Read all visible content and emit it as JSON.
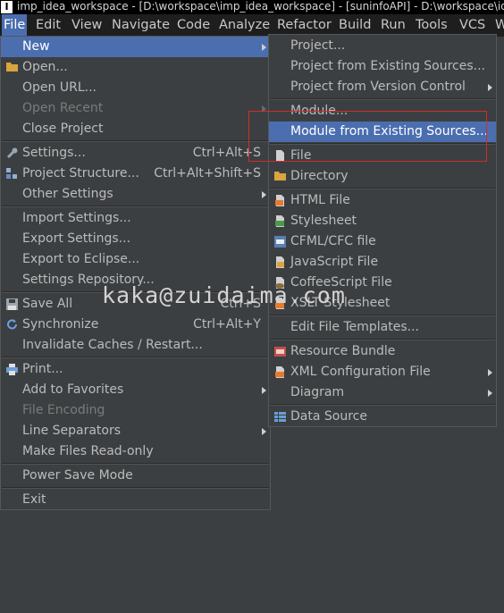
{
  "window": {
    "title": "imp_idea_workspace - [D:\\workspace\\imp_idea_workspace] - [suninfoAPI] - D:\\workspace\\idea"
  },
  "menubar": {
    "items": [
      {
        "label": "File"
      },
      {
        "label": "Edit"
      },
      {
        "label": "View"
      },
      {
        "label": "Navigate"
      },
      {
        "label": "Code"
      },
      {
        "label": "Analyze"
      },
      {
        "label": "Refactor"
      },
      {
        "label": "Build"
      },
      {
        "label": "Run"
      },
      {
        "label": "Tools"
      },
      {
        "label": "VCS"
      },
      {
        "label": "W"
      }
    ]
  },
  "file_menu": {
    "items": [
      {
        "label": "New"
      },
      {
        "label": "Open..."
      },
      {
        "label": "Open URL..."
      },
      {
        "label": "Open Recent"
      },
      {
        "label": "Close Project"
      },
      {
        "label": "Settings...",
        "shortcut": "Ctrl+Alt+S"
      },
      {
        "label": "Project Structure...",
        "shortcut": "Ctrl+Alt+Shift+S"
      },
      {
        "label": "Other Settings"
      },
      {
        "label": "Import Settings..."
      },
      {
        "label": "Export Settings..."
      },
      {
        "label": "Export to Eclipse..."
      },
      {
        "label": "Settings Repository..."
      },
      {
        "label": "Save All",
        "shortcut": "Ctrl+S"
      },
      {
        "label": "Synchronize",
        "shortcut": "Ctrl+Alt+Y"
      },
      {
        "label": "Invalidate Caches / Restart..."
      },
      {
        "label": "Print..."
      },
      {
        "label": "Add to Favorites"
      },
      {
        "label": "File Encoding"
      },
      {
        "label": "Line Separators"
      },
      {
        "label": "Make Files Read-only"
      },
      {
        "label": "Power Save Mode"
      },
      {
        "label": "Exit"
      }
    ]
  },
  "new_submenu": {
    "items": [
      {
        "label": "Project..."
      },
      {
        "label": "Project from Existing Sources..."
      },
      {
        "label": "Project from Version Control"
      },
      {
        "label": "Module..."
      },
      {
        "label": "Module from Existing Sources..."
      },
      {
        "label": "File"
      },
      {
        "label": "Directory"
      },
      {
        "label": "HTML File"
      },
      {
        "label": "Stylesheet"
      },
      {
        "label": "CFML/CFC file"
      },
      {
        "label": "JavaScript File"
      },
      {
        "label": "CoffeeScript File"
      },
      {
        "label": "XSLT Stylesheet"
      },
      {
        "label": "Edit File Templates..."
      },
      {
        "label": "Resource Bundle"
      },
      {
        "label": "XML Configuration File"
      },
      {
        "label": "Diagram"
      },
      {
        "label": "Data Source"
      }
    ]
  },
  "watermark": "kaka@zuidaima.com",
  "colors": {
    "menu_bg": "#3c3f41",
    "selection": "#4b6eaf",
    "menubar_bg": "#1e1e1e",
    "highlight_box": "#d32b2b"
  },
  "icons": {
    "app": "intellij-icon",
    "open": "folder-icon",
    "settings": "wrench-icon",
    "project_structure": "project-structure-icon",
    "save_all": "save-icon",
    "synchronize": "refresh-icon",
    "print": "printer-icon",
    "file": "file-icon",
    "directory": "folder-icon",
    "html": "html-file-icon",
    "stylesheet": "css-file-icon",
    "cfml": "cfml-file-icon",
    "javascript": "js-file-icon",
    "coffeescript": "coffeescript-file-icon",
    "xslt": "xslt-file-icon",
    "resource_bundle": "resource-bundle-icon",
    "xml_config": "xml-config-icon",
    "data_source": "database-icon"
  }
}
